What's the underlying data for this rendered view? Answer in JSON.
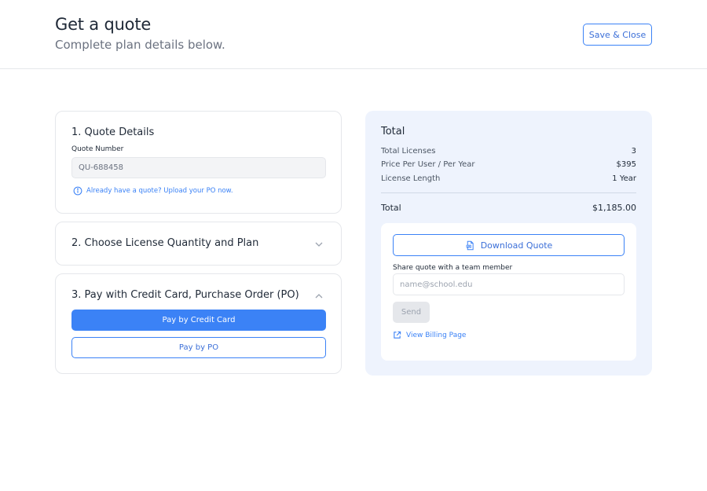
{
  "header": {
    "title": "Get a quote",
    "subtitle": "Complete plan details below.",
    "save_close_label": "Save & Close"
  },
  "quote_details": {
    "title": "1. Quote Details",
    "quote_number_label": "Quote Number",
    "quote_number_value": "QU-688458",
    "upload_link": "Already have a quote? Upload your PO now."
  },
  "license": {
    "title": "2. Choose License Quantity and Plan",
    "expanded": false
  },
  "payment": {
    "title": "3. Pay with Credit Card, Purchase Order (PO)",
    "expanded": true,
    "credit_card_label": "Pay by Credit Card",
    "po_label": "Pay by PO"
  },
  "summary": {
    "title": "Total",
    "rows": [
      {
        "label": "Total Licenses",
        "value": "3"
      },
      {
        "label": "Price Per User / Per Year",
        "value": "$395"
      },
      {
        "label": "License Length",
        "value": "1 Year"
      }
    ],
    "total_label": "Total",
    "total_value": "$1,185.00",
    "download_label": "Download Quote",
    "share_label": "Share quote with a team member",
    "email_placeholder": "name@school.edu",
    "send_label": "Send",
    "billing_link": "View Billing Page"
  },
  "colors": {
    "accent": "#3b82f6",
    "summary_bg": "#eef3fd",
    "text": "#1f2937",
    "muted": "#6b7280"
  }
}
